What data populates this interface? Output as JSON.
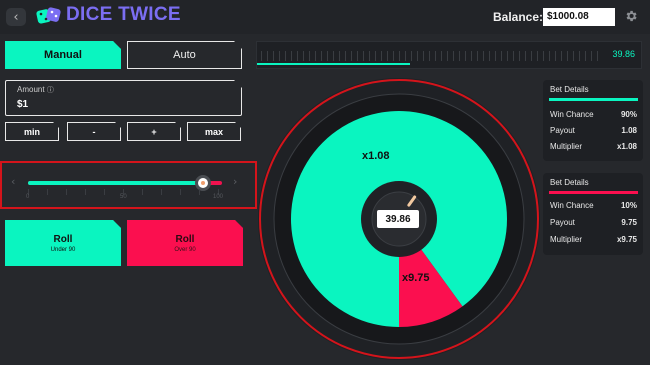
{
  "header": {
    "back_icon": "chevron-left-icon",
    "logo_icon": "dice-icon",
    "app_title": "DICE TWICE",
    "balance_label": "Balance:",
    "balance_value": "$1000.08",
    "settings_icon": "gear-icon"
  },
  "modes": {
    "manual_label": "Manual",
    "auto_label": "Auto",
    "active": "Manual"
  },
  "result_track": {
    "value": "39.86",
    "fill_fraction": 0.3986
  },
  "amount": {
    "label": "Amount",
    "info_icon": "info-icon",
    "value": "$1"
  },
  "adjust_buttons": [
    {
      "label": "min"
    },
    {
      "label": "-"
    },
    {
      "label": "+"
    },
    {
      "label": "max"
    }
  ],
  "slider": {
    "value": 90,
    "min": 0,
    "max": 100,
    "scale_labels": [
      "0",
      "50",
      "100"
    ],
    "left_arrow_icon": "chevron-left-icon",
    "right_arrow_icon": "chevron-right-icon"
  },
  "roll_under": {
    "title": "Roll",
    "subtitle": "Under 90"
  },
  "roll_over": {
    "title": "Roll",
    "subtitle": "Over 90"
  },
  "wheel": {
    "green_label": "x1.08",
    "red_label": "x9.75",
    "center_value": "39.86",
    "green_fraction": 0.9,
    "green_color": "#0af5c0",
    "red_color": "#fb0f4f"
  },
  "bet_details": [
    {
      "title": "Bet Details",
      "accent": "#0af5c0",
      "rows": [
        {
          "key": "Win Chance",
          "value": "90%"
        },
        {
          "key": "Payout",
          "value": "1.08"
        },
        {
          "key": "Multiplier",
          "value": "x1.08"
        }
      ]
    },
    {
      "title": "Bet Details",
      "accent": "#fb0f4f",
      "rows": [
        {
          "key": "Win Chance",
          "value": "10%"
        },
        {
          "key": "Payout",
          "value": "9.75"
        },
        {
          "key": "Multiplier",
          "value": "x9.75"
        }
      ]
    }
  ]
}
